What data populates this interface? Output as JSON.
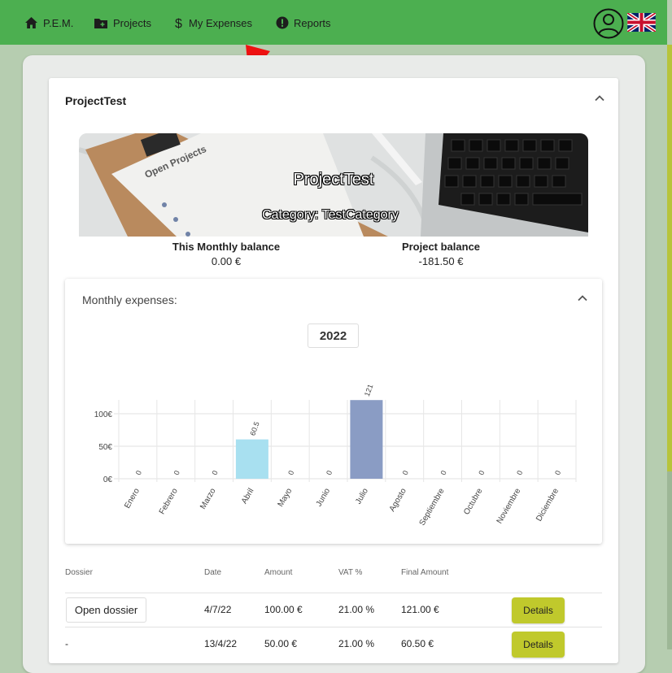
{
  "nav": {
    "brand": "P.E.M.",
    "projects": "Projects",
    "my_expenses": "My Expenses",
    "reports": "Reports"
  },
  "project": {
    "title": "ProjectTest",
    "banner_title": "ProjectTest",
    "banner_category": "Category: TestCategory",
    "banner_clipboard_text": "Open Projects",
    "monthly_balance_label": "This Monthly balance",
    "monthly_balance_value": "0.00 €",
    "project_balance_label": "Project balance",
    "project_balance_value": "-181.50 €"
  },
  "monthly": {
    "label": "Monthly expenses:",
    "year": "2022"
  },
  "chart_data": {
    "type": "bar",
    "categories": [
      "Enero",
      "Febrero",
      "Marzo",
      "Abril",
      "Mayo",
      "Junio",
      "Julio",
      "Agosto",
      "Septiembre",
      "Octubre",
      "Noviembre",
      "Diciembre"
    ],
    "values": [
      0,
      0,
      0,
      60.5,
      0,
      0,
      121,
      0,
      0,
      0,
      0,
      0
    ],
    "data_labels": [
      "0",
      "0",
      "0",
      "60.5",
      "0",
      "0",
      "121",
      "0",
      "0",
      "0",
      "0",
      "0"
    ],
    "colors": [
      "#a8e0f0",
      "#a8e0f0",
      "#a8e0f0",
      "#a8e0f0",
      "#8a9cc4",
      "#8a9cc4",
      "#8a9cc4",
      "#8a9cc4",
      "#8a9cc4",
      "#8a9cc4",
      "#8a9cc4",
      "#8a9cc4"
    ],
    "y_ticks": [
      "0€",
      "50€",
      "100€"
    ],
    "y_tick_values": [
      0,
      50,
      100
    ],
    "ylim": [
      0,
      121
    ],
    "grid": true,
    "xlabel": "",
    "ylabel": ""
  },
  "table": {
    "headers": [
      "Dossier",
      "Date",
      "Amount",
      "VAT %",
      "Final Amount"
    ],
    "rows": [
      {
        "dossier": "Open dossier",
        "date": "4/7/22",
        "amount": "100.00 €",
        "vat": "21.00 %",
        "final": "121.00 €",
        "action": "Details"
      },
      {
        "dossier": "-",
        "date": "13/4/22",
        "amount": "50.00 €",
        "vat": "21.00 %",
        "final": "60.50 €",
        "action": "Details"
      }
    ]
  },
  "colors": {
    "navbar": "#4caf50",
    "accent_button": "#c0c92c",
    "arrow": "#ee1111"
  }
}
